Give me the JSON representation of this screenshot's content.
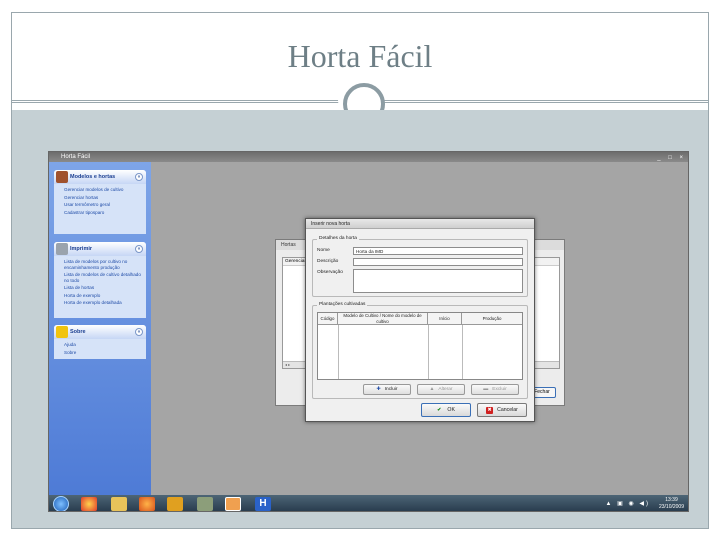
{
  "slide": {
    "title": "Horta Fácil"
  },
  "app": {
    "window_title": "Horta Fácil",
    "window_controls": "_ □ ×"
  },
  "side_panels": [
    {
      "header": "Modelos e hortas",
      "chevron": "«",
      "items": [
        "Gerenciar modelos de cultivo",
        "Gerenciar hortas",
        "Usar termômetro geral",
        "Cadastrar tiposparo"
      ]
    },
    {
      "header": "Imprimir",
      "chevron": "«",
      "items": [
        "Lista de modelos por cultivo no encaminhamento produção",
        "Lista de modelos de cultivo detalhado no todo",
        "Lista de hortas",
        "Horta de exemplo",
        "Horta de exemplo detalhada"
      ]
    },
    {
      "header": "Sobre",
      "chevron": "«",
      "items": [
        "Ajuda",
        "Sobre"
      ]
    }
  ],
  "background_window": {
    "title": "Hortas",
    "inner_title": "Gerenciar",
    "scroll_hint": "◂ ▸",
    "button_label": "Fechar"
  },
  "dialog": {
    "title": "Inserir nova horta",
    "details_group": "Detalhes da horta",
    "fields": [
      {
        "label": "Nome",
        "value": "Horta da IMD"
      },
      {
        "label": "Descrição",
        "value": ""
      },
      {
        "label": "Observação",
        "value": ""
      }
    ],
    "plantings_group": "Plantações cultivadas",
    "table_headers": {
      "codigo": "Código",
      "modelo": "Modelo de Cultivo / Nome do modelo de cultivo",
      "inicio": "Início",
      "producao": "Produção"
    },
    "buttons": {
      "incluir": "Incluir",
      "alterar": "Alterar",
      "excluir": "Excluir",
      "ok": "OK",
      "cancelar": "Cancelar"
    }
  },
  "taskbar": {
    "time": "13:39",
    "date": "23/10/2009",
    "tray": "▲ ▣ ◉ ◀)"
  },
  "colors": {
    "slide_body": "#c5d0d4",
    "side_pane": "#4e7bd6",
    "taskbar": "#25384a",
    "focus_border": "#3a6fb6"
  }
}
